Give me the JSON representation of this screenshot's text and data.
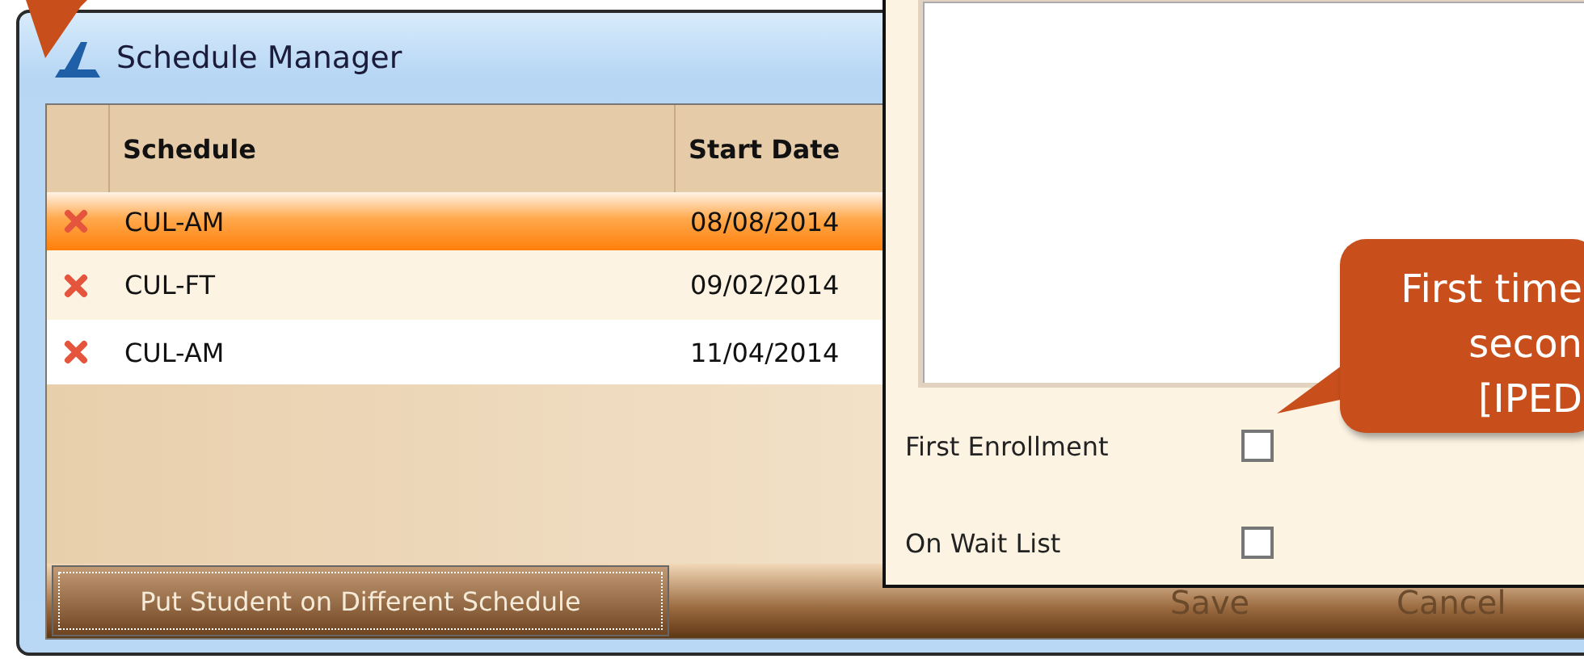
{
  "window": {
    "title": "Schedule Manager"
  },
  "grid": {
    "columns": [
      "Schedule",
      "Start Date"
    ],
    "rows": [
      {
        "schedule": "CUL-AM",
        "start_date": "08/08/2014",
        "selected": true
      },
      {
        "schedule": "CUL-FT",
        "start_date": "09/02/2014",
        "selected": false
      },
      {
        "schedule": "CUL-AM",
        "start_date": "11/04/2014",
        "selected": false
      }
    ]
  },
  "footer_button": "Put Student on Different Schedule",
  "dialog_buttons": [
    {
      "label": "Save",
      "disabled": true
    },
    {
      "label": "Cancel",
      "disabled": true
    }
  ],
  "popup": {
    "fields": [
      {
        "label": "First Enrollment",
        "checked": false
      },
      {
        "label": "On Wait List",
        "checked": false
      }
    ]
  },
  "callout": {
    "lines": [
      "First time",
      "secon",
      "[IPED"
    ]
  }
}
